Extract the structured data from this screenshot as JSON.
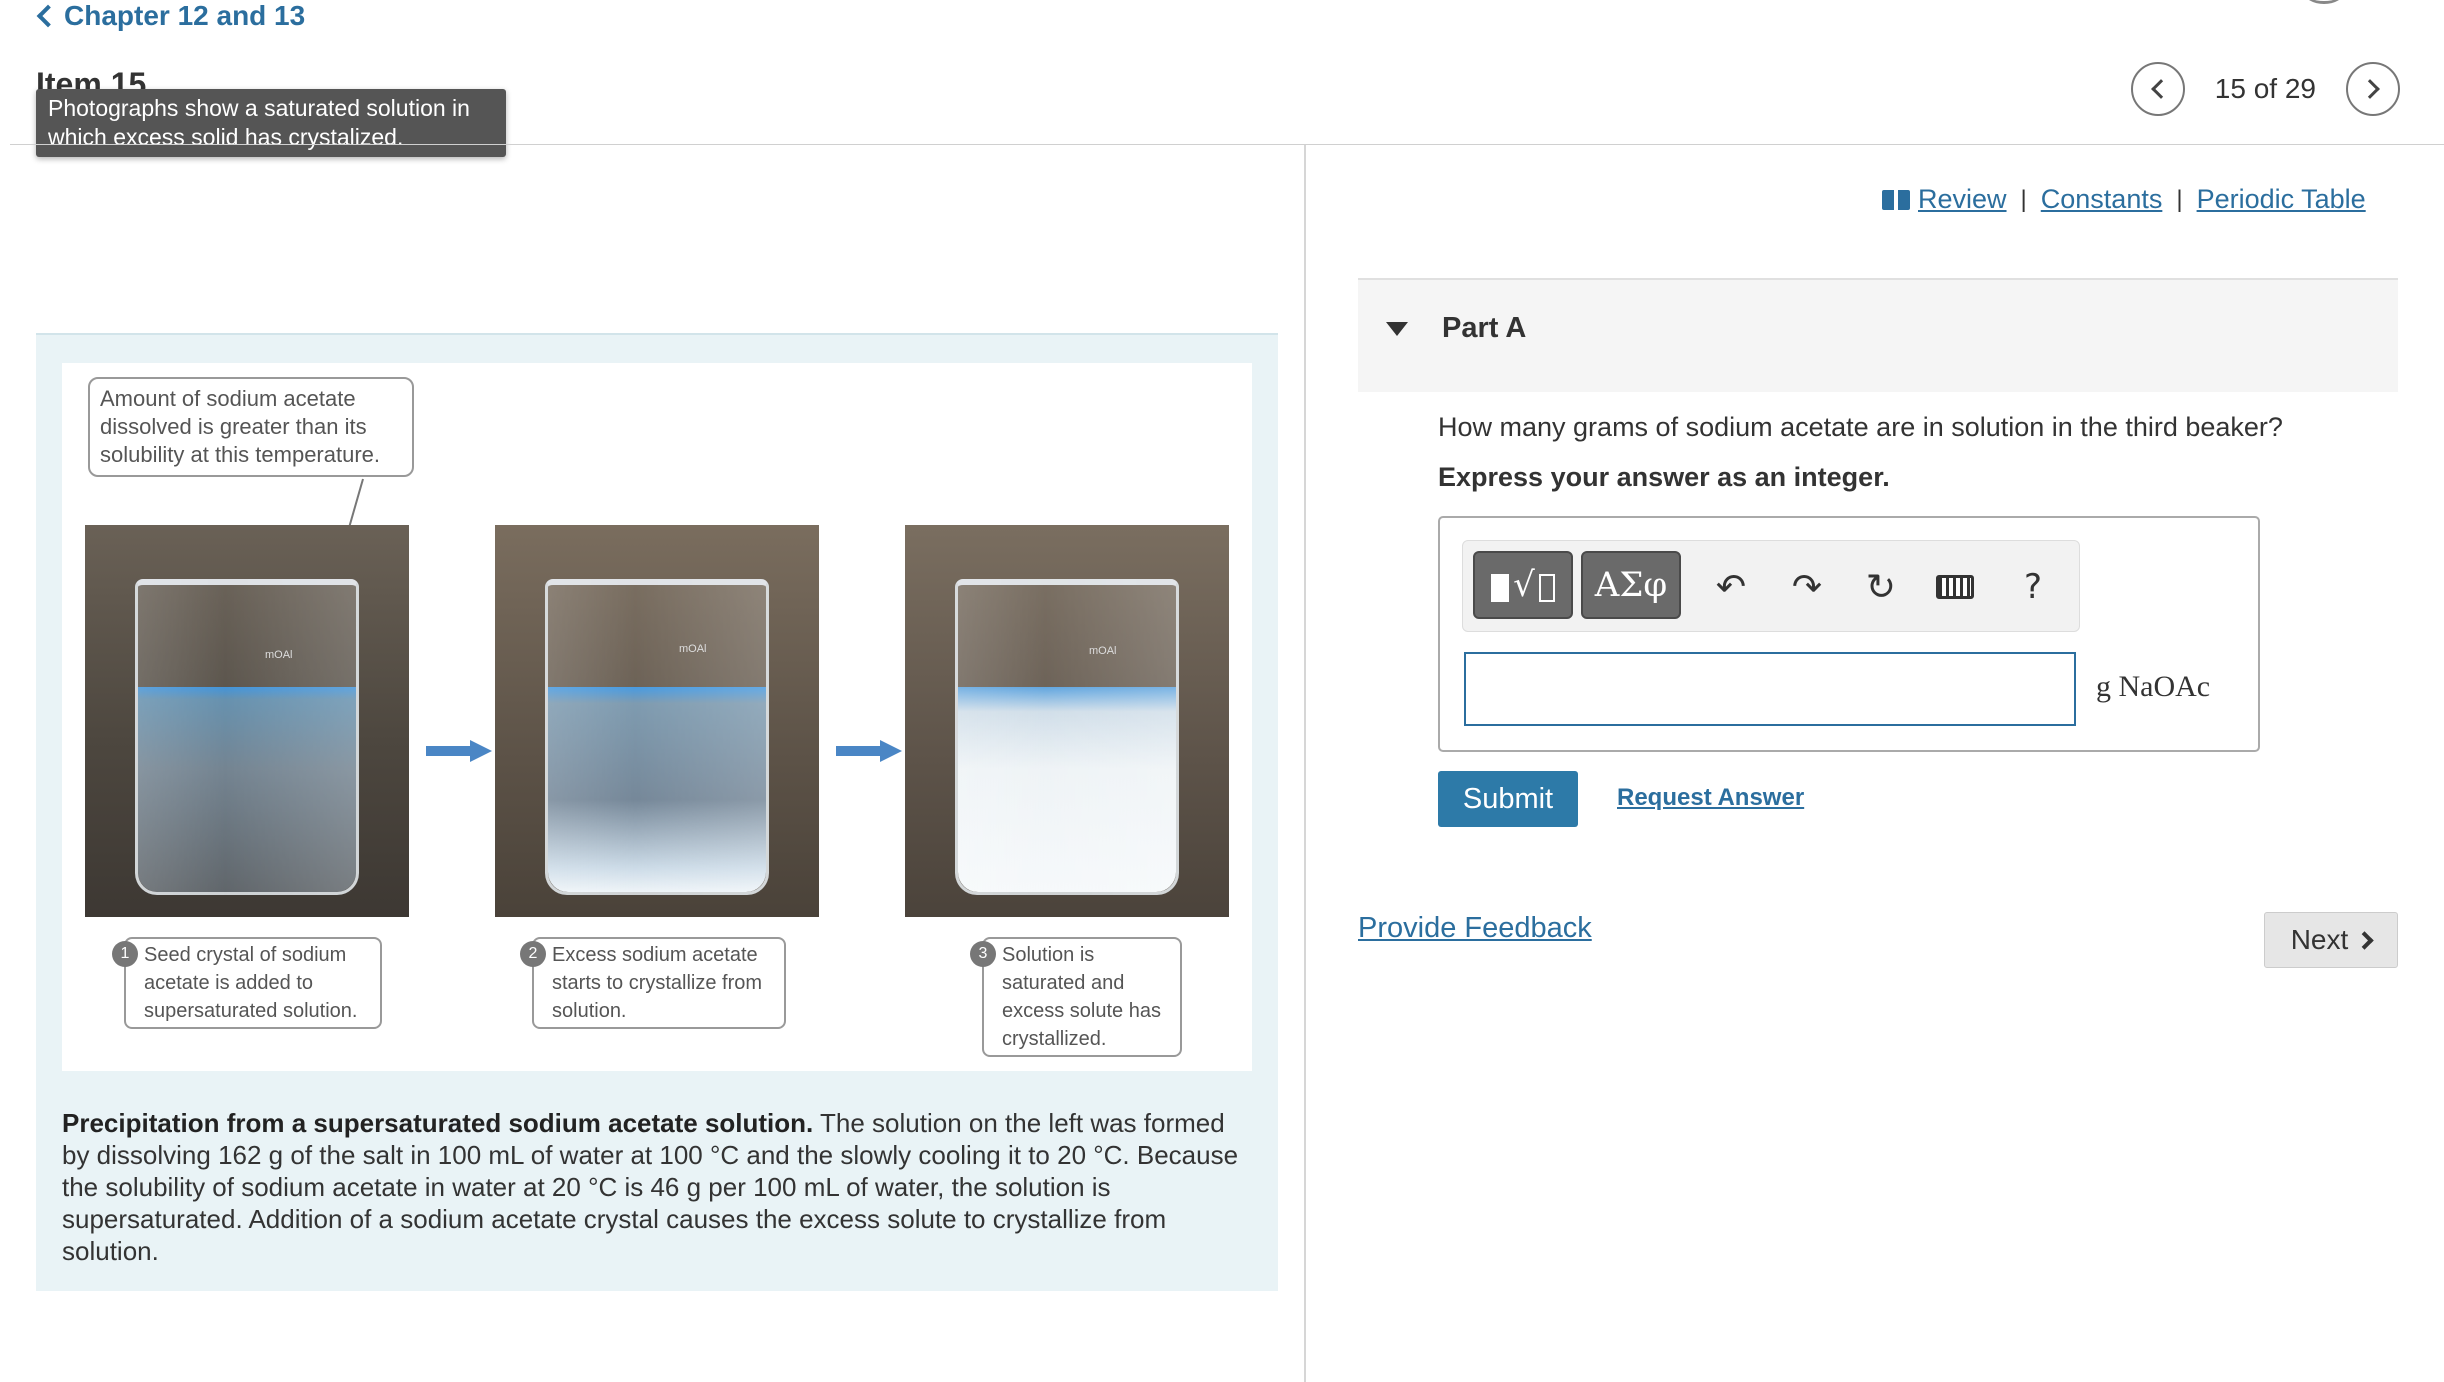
{
  "header": {
    "back_label": "Chapter 12 and 13",
    "item_title": "Item 15",
    "tooltip": "Photographs show a saturated solution in which excess solid has crystalized.",
    "pager": {
      "count": "15 of 29"
    }
  },
  "figure": {
    "top_callout": "Amount of sodium acetate dissolved is greater than its solubility at this temperature.",
    "beaker_label": "mOAl",
    "steps": [
      {
        "num": "1",
        "text": "Seed crystal of sodium acetate is added to supersaturated solution."
      },
      {
        "num": "2",
        "text": "Excess sodium acetate starts to crystallize from solution."
      },
      {
        "num": "3",
        "text": "Solution is saturated and excess solute has crystallized."
      }
    ],
    "caption_bold": "Precipitation from a supersaturated sodium acetate solution.",
    "caption_text": " The solution on the left was formed by dissolving 162 g of the salt in 100 mL of water at 100 °C and the slowly cooling it to 20 °C. Because the solubility of sodium acetate in water at 20 °C is 46 g per 100 mL of water, the solution is supersaturated. Addition of a sodium acetate crystal causes the excess solute to crystallize from solution."
  },
  "links": {
    "review": "Review",
    "constants": "Constants",
    "periodic_table": "Periodic Table",
    "separator": "|"
  },
  "part": {
    "title": "Part A",
    "question": "How many grams of sodium acetate are in solution in the third beaker?",
    "instruction": "Express your answer as an integer.",
    "toolbar": {
      "greek_label": "ΑΣφ",
      "help_label": "?"
    },
    "answer_value": "",
    "unit": "g NaOAc",
    "submit_label": "Submit",
    "request_label": "Request Answer"
  },
  "footer": {
    "feedback_label": "Provide Feedback",
    "next_label": "Next"
  },
  "colors": {
    "link": "#2b6e9e",
    "submit": "#2d7aa8",
    "arrow": "#4a86c5",
    "panel_bg": "#e9f3f6"
  },
  "icons": [
    "chevron-left-icon",
    "chevron-right-icon",
    "book-icon",
    "caret-down-icon",
    "undo-icon",
    "redo-icon",
    "reset-icon",
    "keyboard-icon",
    "help-icon"
  ]
}
